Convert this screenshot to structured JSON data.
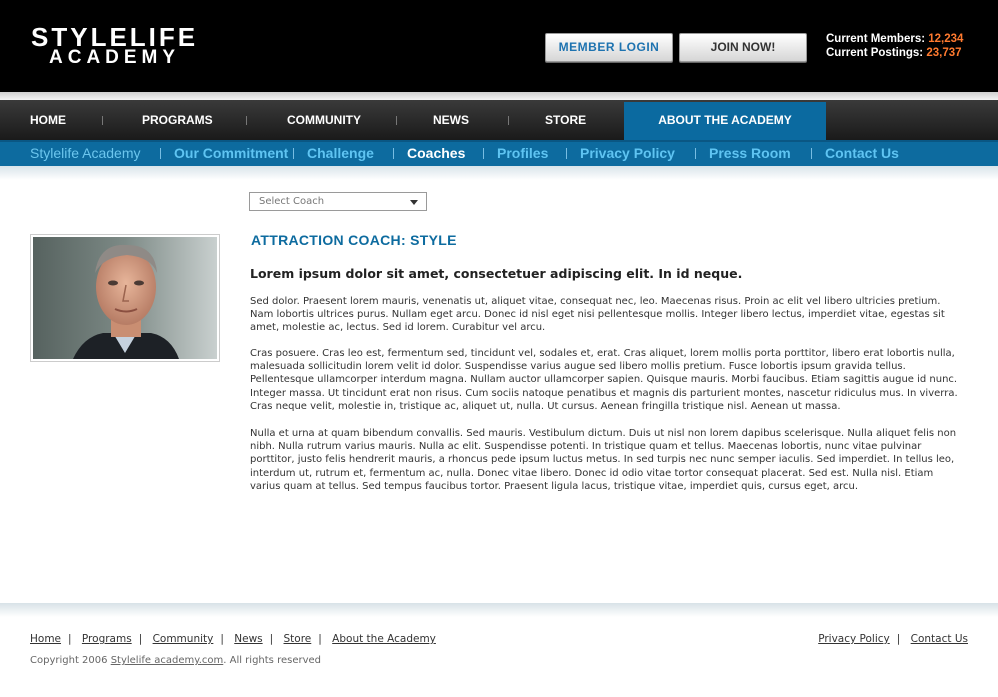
{
  "logo": {
    "line1": "STYLELIFE",
    "line2": "ACADEMY"
  },
  "header": {
    "login_label": "MEMBER  LOGIN",
    "join_label": "JOIN NOW!",
    "members_label": "Current Members:",
    "members_value": "12,234",
    "postings_label": "Current Postings:",
    "postings_value": "23,737"
  },
  "mainnav": [
    "HOME",
    "PROGRAMS",
    "COMMUNITY",
    "NEWS",
    "STORE",
    "ABOUT THE ACADEMY"
  ],
  "subnav": [
    "Stylelife Academy",
    "Our Commitment",
    "Challenge",
    "Coaches",
    "Profiles",
    "Privacy Policy",
    "Press Room",
    "Contact Us"
  ],
  "content": {
    "select_placeholder": "Select Coach",
    "title": "ATTRACTION COACH: STYLE",
    "lead": "Lorem ipsum dolor sit amet, consectetuer adipiscing elit. In id neque.",
    "paragraphs": [
      "Sed dolor. Praesent lorem mauris, venenatis ut, aliquet vitae, consequat nec, leo. Maecenas risus. Proin ac elit vel libero ultricies pretium. Nam lobortis ultrices purus. Nullam eget arcu. Donec id nisl eget nisi pellentesque mollis. Integer libero lectus, imperdiet vitae, egestas sit amet, molestie ac, lectus. Sed id lorem. Curabitur vel arcu.",
      "Cras posuere. Cras leo est, fermentum sed, tincidunt vel, sodales et, erat. Cras aliquet, lorem mollis porta porttitor, libero erat lobortis nulla, malesuada sollicitudin lorem velit id dolor. Suspendisse varius augue sed libero mollis pretium. Fusce lobortis ipsum gravida tellus. Pellentesque ullamcorper interdum magna. Nullam auctor ullamcorper sapien. Quisque mauris. Morbi faucibus. Etiam sagittis augue id nunc. Integer massa. Ut tincidunt erat non risus. Cum sociis natoque penatibus et magnis dis parturient montes, nascetur ridiculus mus. In viverra. Cras neque velit, molestie in, tristique ac, aliquet ut, nulla. Ut cursus. Aenean fringilla tristique nisl. Aenean ut massa.",
      "Nulla et urna at quam bibendum convallis. Sed mauris. Vestibulum dictum. Duis ut nisl non lorem dapibus scelerisque. Nulla aliquet felis non nibh. Nulla rutrum varius mauris. Nulla ac elit. Suspendisse potenti. In tristique quam et tellus. Maecenas lobortis, nunc vitae pulvinar porttitor, justo felis hendrerit mauris, a rhoncus pede ipsum luctus metus. In sed turpis nec nunc semper iaculis. Sed imperdiet. In tellus leo, interdum ut, rutrum et, fermentum ac, nulla. Donec vitae libero. Donec id odio vitae tortor consequat placerat. Sed est. Nulla nisl. Etiam varius quam at tellus. Sed tempus faucibus tortor. Praesent ligula lacus, tristique vitae, imperdiet quis, cursus eget, arcu."
    ]
  },
  "footer": {
    "links": [
      "Home",
      "Programs",
      "Community",
      "News",
      "Store",
      "About the Academy"
    ],
    "right_links": [
      "Privacy Policy",
      "Contact Us"
    ],
    "copyright_prefix": "Copyright 2006",
    "copyright_link": "Stylelife academy.com",
    "copyright_suffix": ".  All rights reserved"
  },
  "colors": {
    "brand_blue": "#0d6b9f",
    "accent_orange": "#ff7a2f",
    "subnav_link": "#5fc4f2"
  }
}
